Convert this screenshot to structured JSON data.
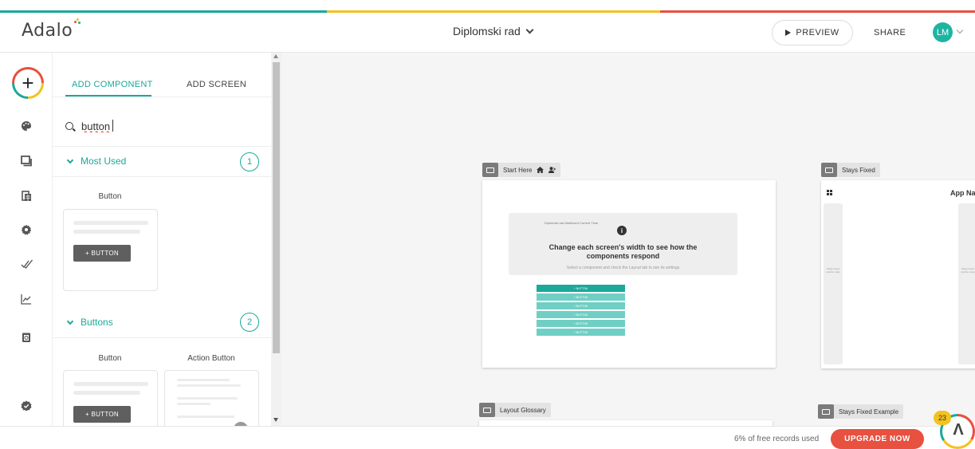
{
  "header": {
    "logo_text": "Adalo",
    "app_title": "Diplomski rad",
    "preview_label": "PREVIEW",
    "share_label": "SHARE",
    "avatar_initials": "LM"
  },
  "brand_colors": {
    "teal": "#1aa99a",
    "yellow": "#f4c21f",
    "red": "#e8503f"
  },
  "rail": {
    "add_label": "+",
    "items": [
      {
        "icon": "palette-icon"
      },
      {
        "icon": "screens-icon"
      },
      {
        "icon": "database-icon"
      },
      {
        "icon": "gear-icon"
      },
      {
        "icon": "publish-check-icon"
      },
      {
        "icon": "analytics-icon"
      },
      {
        "icon": "clipboard-icon"
      },
      {
        "icon": "verified-badge-icon"
      }
    ]
  },
  "panel": {
    "tabs": [
      {
        "label": "ADD COMPONENT",
        "active": true
      },
      {
        "label": "ADD SCREEN",
        "active": false
      }
    ],
    "search": {
      "value": "button"
    },
    "sections": [
      {
        "title": "Most Used",
        "count": "1",
        "components": [
          {
            "label": "Button",
            "button_label": "+ BUTTON"
          }
        ]
      },
      {
        "title": "Buttons",
        "count": "2",
        "components": [
          {
            "label": "Button",
            "button_label": "+ BUTTON"
          },
          {
            "label": "Action Button"
          }
        ]
      }
    ]
  },
  "canvas": {
    "screens": [
      {
        "label": "Start Here",
        "info_small": "Diplomski rad Mailhoord Current Time",
        "info_heading": "Change each screen's width to see how the components respond",
        "info_sub": "Select a component and check the Layout tab to see its settings",
        "buttons": [
          "+ BUTTON",
          "+ BUTTON",
          "+ BUTTON",
          "+ BUTTON",
          "+ BUTTON",
          "+ BUTTON"
        ]
      },
      {
        "label": "Stays Fixed",
        "heading": "App Na",
        "column_text": "Stays Fixed (anchor side)"
      },
      {
        "label": "Layout Glossary"
      },
      {
        "label": "Stays Fixed Example"
      }
    ]
  },
  "footer": {
    "records_text": "6% of free records used",
    "upgrade_label": "UPGRADE NOW",
    "notification_count": "23"
  }
}
